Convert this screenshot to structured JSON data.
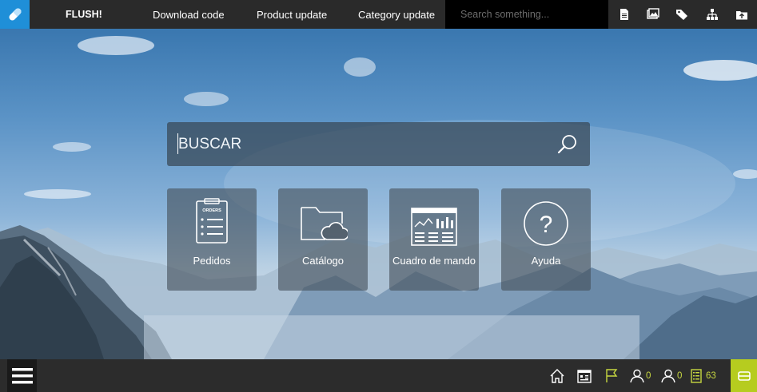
{
  "app": {
    "brand": "FLUSH!",
    "nav": [
      "Download code",
      "Product update",
      "Category update"
    ],
    "search_placeholder": "Search something...",
    "top_icons": [
      "document-icon",
      "image-gallery-icon",
      "tags-icon",
      "sitemap-icon",
      "cloud-upload-icon"
    ]
  },
  "main": {
    "search_placeholder": "BUSCAR",
    "tiles": [
      {
        "label": "Pedidos",
        "icon": "orders-clipboard-icon",
        "icon_caption": "ORDERS"
      },
      {
        "label": "Catálogo",
        "icon": "cloud-folder-icon"
      },
      {
        "label": "Cuadro de mando",
        "icon": "dashboard-icon"
      },
      {
        "label": "Ayuda",
        "icon": "help-icon"
      }
    ]
  },
  "bottom": {
    "icons": [
      "home-icon",
      "calendar-icon",
      "flag-icon",
      "user-icon",
      "user-outline-icon",
      "list-icon"
    ],
    "counts": {
      "user": "0",
      "user_outline": "0",
      "list": "63"
    },
    "accent": "#b6cc1f"
  },
  "colors": {
    "topbar": "#2a2a2a",
    "logo_bg": "#1f8fd8",
    "bottombar": "#2c2c2c"
  }
}
